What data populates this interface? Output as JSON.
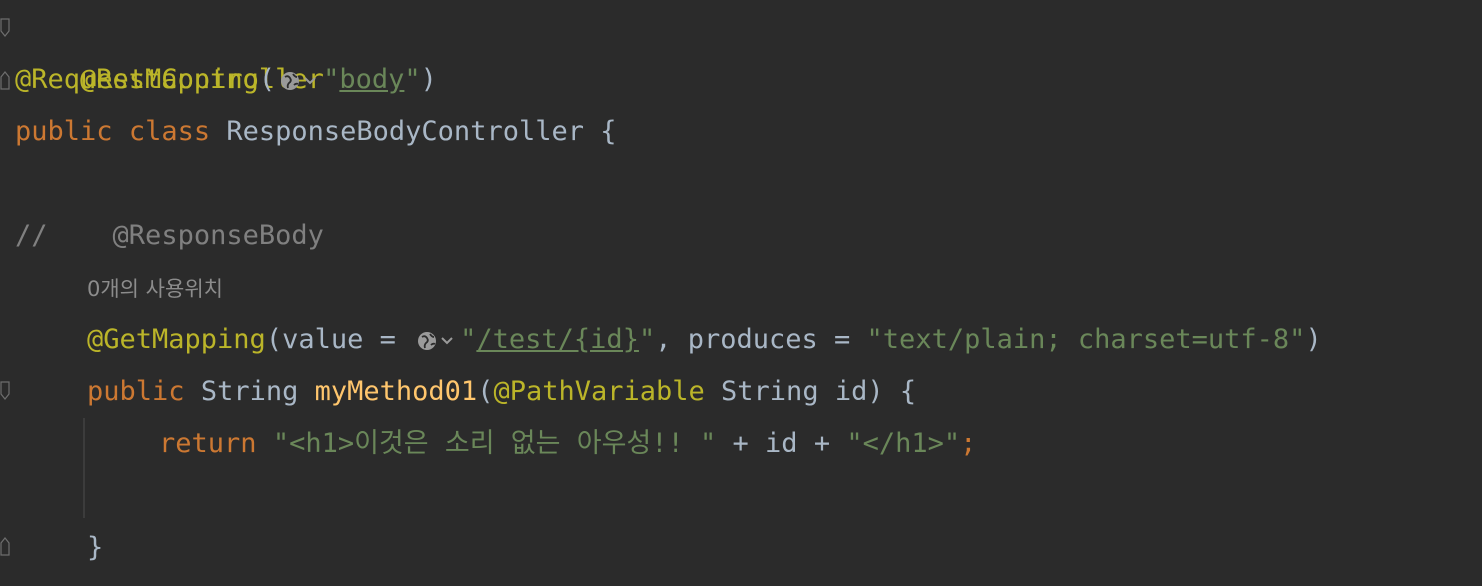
{
  "code": {
    "line1": {
      "annotation": "@RestController"
    },
    "line2": {
      "annotation": "@RequestMapping",
      "open": "(",
      "quote_open": "\"",
      "path": "body",
      "quote_close": "\"",
      "close": ")"
    },
    "line3": {
      "kw1": "public",
      "kw2": "class",
      "name": "ResponseBodyController",
      "brace": "{"
    },
    "line5": {
      "comment_slashes": "//",
      "comment_text": "@ResponseBody"
    },
    "usage_hint": "0개의 사용위치",
    "line6": {
      "annotation": "@GetMapping",
      "open": "(value = ",
      "quote_open": "\"",
      "path": "/test/{id}",
      "quote_close": "\"",
      "mid": ", produces = ",
      "produces": "\"text/plain; charset=utf-8\"",
      "close": ")"
    },
    "line7": {
      "kw": "public",
      "type": "String",
      "method": "myMethod01",
      "open": "(",
      "param_annotation": "@PathVariable",
      "rest": " String id) {"
    },
    "line8": {
      "kw": "return",
      "str1": "\"<h1>이것은 소리 없는 아우성!! \"",
      "plus1": " + id + ",
      "str2": "\"</h1>\"",
      "semi": ";"
    },
    "line10": {
      "brace": "}"
    }
  },
  "icons": {
    "url_globe": "globe-icon",
    "dropdown": "chevron-down-icon",
    "fold": "fold-marker-icon"
  },
  "colors": {
    "background": "#2b2b2b",
    "annotation": "#bbb529",
    "keyword": "#cc7832",
    "string": "#6a8759",
    "comment": "#808080",
    "method": "#ffc66d",
    "text": "#a9b7c6"
  }
}
